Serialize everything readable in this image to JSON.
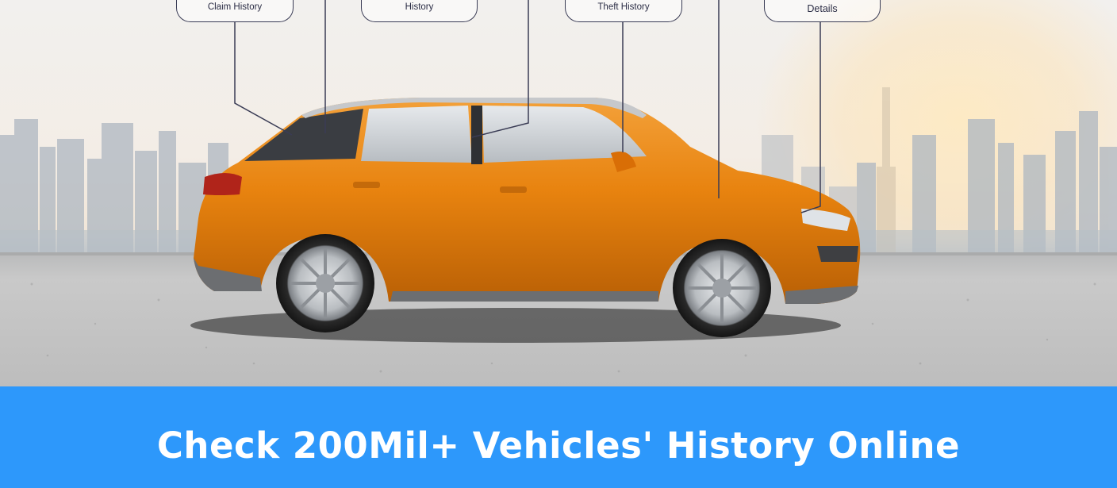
{
  "hero": {
    "callouts": {
      "claim": "Claim History",
      "service": "History",
      "theft": "Theft History",
      "details": "Details"
    }
  },
  "banner": {
    "headline": "Check 200Mil+ Vehicles' History Online"
  },
  "colors": {
    "banner_bg": "#2d98fb",
    "car_body": "#e8830f",
    "callout_border": "#3a3c55"
  },
  "icons": [
    "car-illustration",
    "city-skyline"
  ]
}
